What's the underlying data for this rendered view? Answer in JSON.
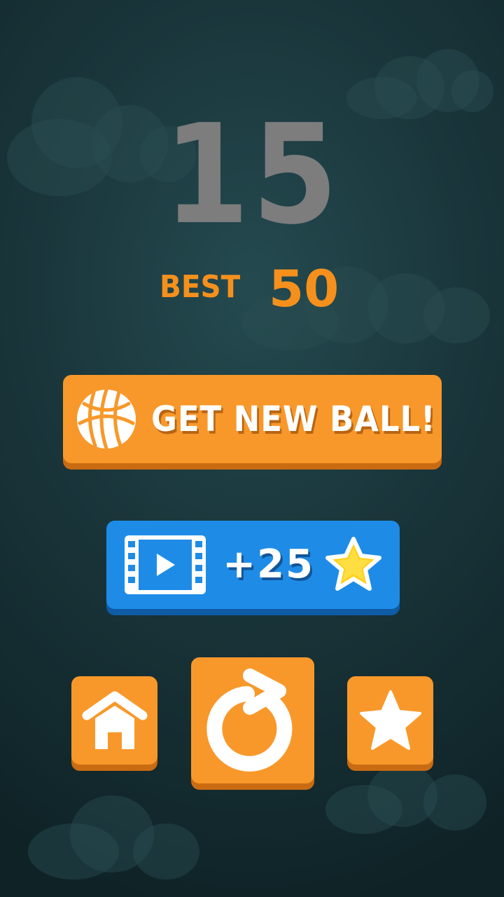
{
  "score": "15",
  "best": {
    "label": "BEST",
    "value": "50"
  },
  "buttons": {
    "new_ball": {
      "label": "GET NEW BALL!",
      "icon": "basketball-icon"
    },
    "video_reward": {
      "label": "+25",
      "icons": [
        "video-icon",
        "star-icon"
      ]
    },
    "home": {
      "icon": "home-icon"
    },
    "replay": {
      "icon": "replay-icon"
    },
    "rate": {
      "icon": "star-icon"
    }
  },
  "colors": {
    "accent_orange": "#f8982a",
    "accent_blue": "#1e8ce6",
    "score_gray": "#7d7d7d",
    "star_yellow": "#ffd21f"
  }
}
